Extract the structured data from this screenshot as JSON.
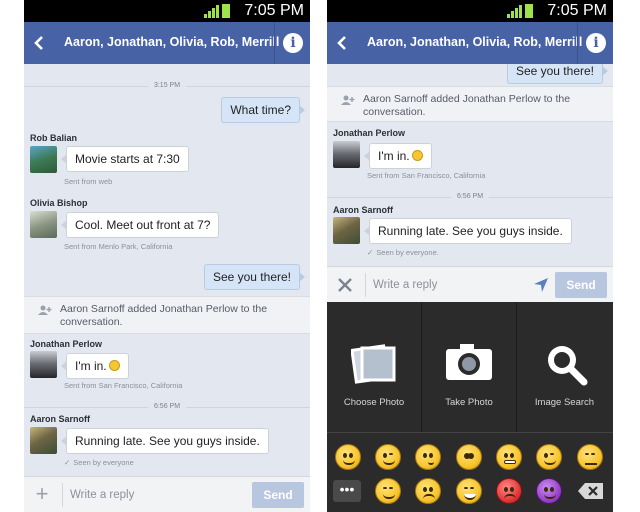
{
  "status_bar": {
    "time": "7:05 PM"
  },
  "header": {
    "title": "Aaron, Jonathan, Olivia, Rob, Merrill"
  },
  "screen1": {
    "time_1": "3:15 PM",
    "out_1": "What time?",
    "rob": {
      "name": "Rob Balian",
      "message": "Movie starts at 7:30",
      "meta": "Sent from web"
    },
    "olivia": {
      "name": "Olivia Bishop",
      "message": "Cool. Meet out front at 7?",
      "meta": "Sent from Menlo Park, California"
    },
    "out_2": "See you there!",
    "system": "Aaron Sarnoff added Jonathan Perlow to the conversation.",
    "jonathan": {
      "name": "Jonathan Perlow",
      "message": "I'm in.",
      "meta": "Sent from San Francisco, California"
    },
    "time_2": "6:56 PM",
    "aaron": {
      "name": "Aaron Sarnoff",
      "message": "Running late. See you guys inside.",
      "meta": "Seen by everyone"
    }
  },
  "screen2": {
    "out_top": "See you there!",
    "system": "Aaron Sarnoff added Jonathan Perlow to the conversation.",
    "jonathan": {
      "name": "Jonathan Perlow",
      "message": "I'm in.",
      "meta": "Sent from San Francisco, California"
    },
    "time": "6:56 PM",
    "aaron": {
      "name": "Aaron Sarnoff",
      "message": "Running late. See you guys inside.",
      "meta": "Seen by everyone."
    }
  },
  "composer": {
    "placeholder": "Write a reply",
    "send_label": "Send"
  },
  "attach_tray": {
    "choose_photo": "Choose Photo",
    "take_photo": "Take Photo",
    "image_search": "Image Search"
  },
  "emoji_icons": [
    "grinning",
    "winking",
    "kissing",
    "flushed",
    "grimacing",
    "tongue-wink",
    "unamused",
    "more",
    "smirking",
    "crying",
    "laughing-tears",
    "angry",
    "devil",
    "delete"
  ],
  "colors": {
    "navbar": "#4763a6",
    "chat_bg": "#e3e7ef",
    "outgoing_bubble": "#d5e5f7",
    "send_button": "#b9c6e0",
    "tray_bg": "#2b2b2b"
  }
}
